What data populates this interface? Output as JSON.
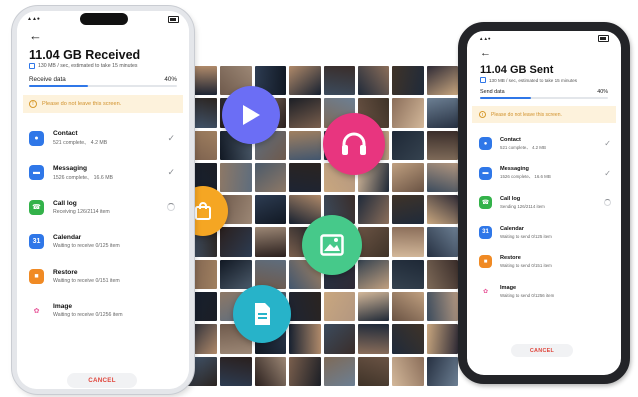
{
  "colors": {
    "accent": "#2f77e8",
    "warning_bg": "#fdf2dc",
    "warning_text": "#d0902a",
    "cancel_text": "#e0443a",
    "icon_contact": "#2f77e8",
    "icon_messaging": "#2f77e8",
    "icon_call_log": "#33b24a",
    "icon_calendar": "#2f77e8",
    "icon_restore": "#f08a24",
    "icon_image": "#e85a9b",
    "bubble_play": "#6b6ef5",
    "bubble_headphones": "#e8357f",
    "bubble_gallery": "#46c98a",
    "bubble_bag": "#f5a623",
    "bubble_file": "#27b3c9"
  },
  "app_bubbles": [
    {
      "name": "play-icon"
    },
    {
      "name": "headphones-icon"
    },
    {
      "name": "gallery-icon"
    },
    {
      "name": "shopping-bag-icon"
    },
    {
      "name": "file-icon"
    }
  ],
  "receiver": {
    "title": "11.04 GB Received",
    "speed_text": "130 MB / sec, estimated to take 15 minutes",
    "progress_label": "Receive data",
    "progress_percent_text": "40%",
    "progress_fraction": 0.4,
    "warning_text": "Please do not leave this screen.",
    "items": [
      {
        "name": "Contact",
        "status": "521 complete、 4.2 MB",
        "icon": "contact-icon",
        "glyph": "●",
        "state": "done"
      },
      {
        "name": "Messaging",
        "status": "1526 complete、 16.6 MB",
        "icon": "messaging-icon",
        "glyph": "▬",
        "state": "done"
      },
      {
        "name": "Call log",
        "status": "Receiving 126/2114 item",
        "icon": "call-log-icon",
        "glyph": "☎",
        "state": "progress"
      },
      {
        "name": "Calendar",
        "status": "Waiting to receive 0/125 item",
        "icon": "calendar-icon",
        "glyph": "31",
        "state": "waiting"
      },
      {
        "name": "Restore",
        "status": "Waiting to receive 0/151 item",
        "icon": "restore-icon",
        "glyph": "■",
        "state": "waiting"
      },
      {
        "name": "Image",
        "status": "Waiting to receive 0/1256 item",
        "icon": "image-icon",
        "glyph": "✿",
        "state": "waiting"
      }
    ],
    "cancel_label": "CANCEL",
    "done_mark": "✓"
  },
  "sender": {
    "title": "11.04 GB  Sent",
    "speed_text": "130 MB / sec, estimated to take 15 minutes",
    "progress_label": "Send data",
    "progress_percent_text": "40%",
    "progress_fraction": 0.4,
    "warning_text": "Please do not leave this screen.",
    "items": [
      {
        "name": "Contact",
        "status": "521 complete、 4.2 MB",
        "icon": "contact-icon",
        "glyph": "●",
        "state": "done"
      },
      {
        "name": "Messaging",
        "status": "1526 complete、 16.6 MB",
        "icon": "messaging-icon",
        "glyph": "▬",
        "state": "done"
      },
      {
        "name": "Call log",
        "status": "Sending 126/2114 item",
        "icon": "call-log-icon",
        "glyph": "☎",
        "state": "progress"
      },
      {
        "name": "Calendar",
        "status": "Waiting to send 0/125 item",
        "icon": "calendar-icon",
        "glyph": "31",
        "state": "waiting"
      },
      {
        "name": "Restore",
        "status": "Waiting to send 0/151 item",
        "icon": "restore-icon",
        "glyph": "■",
        "state": "waiting"
      },
      {
        "name": "Image",
        "status": "Waiting to send 0/1256 item",
        "icon": "image-icon",
        "glyph": "✿",
        "state": "waiting"
      }
    ],
    "cancel_label": "CANCEL",
    "done_mark": "✓"
  },
  "tile_colors": [
    "#1d2433",
    "#6f5a4c",
    "#2d3c52",
    "#b08a6a",
    "#3a2d2a",
    "#8b6e5a",
    "#1f2a3a",
    "#c9a77f",
    "#42566e",
    "#2a1f1d",
    "#9c8775",
    "#1b1e25",
    "#6c7f93",
    "#3f3328",
    "#d3b89a",
    "#263041",
    "#7a5f4d",
    "#111823",
    "#5e6d7d",
    "#a08060",
    "#2e2a35",
    "#c0a080",
    "#35424f",
    "#7e6a58",
    "#162030",
    "#8d7866",
    "#4b5a6a",
    "#2b2420",
    "#b39780",
    "#1e2836",
    "#6a5344",
    "#3b4b5d"
  ]
}
